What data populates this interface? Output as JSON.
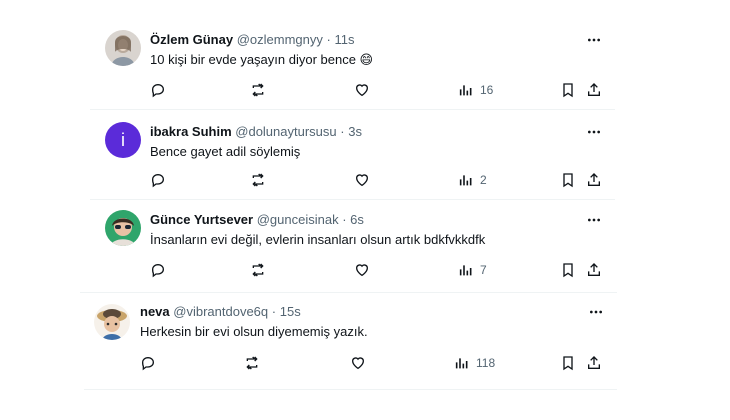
{
  "colors": {
    "text": "#0f1419",
    "muted": "#536471",
    "separator": "#eff3f4",
    "avatar_purple": "#5b2bd9"
  },
  "tweets": [
    {
      "name": "Özlem Günay",
      "handle": "@ozlemmgnyy",
      "time": "11s",
      "text": "10 kişi bir evde yaşayın diyor bence 😄",
      "views": "16"
    },
    {
      "name": "ibakra Suhim",
      "handle": "@dolunaytursusu",
      "time": "3s",
      "text": "Bence gayet adil söylemiş",
      "views": "2",
      "avatar_letter": "i"
    },
    {
      "name": "Günce Yurtsever",
      "handle": "@gunceisinak",
      "time": "6s",
      "text": "İnsanların evi değil, evlerin insanları olsun artık bdkfvkkdfk",
      "views": "7"
    },
    {
      "name": "neva",
      "handle": "@vibrantdove6q",
      "time": "15s",
      "text": "Herkesin bir evi olsun diyememiş yazık.",
      "views": "118"
    }
  ],
  "icons": {
    "reply": "reply-icon",
    "retweet": "retweet-icon",
    "like": "heart-icon",
    "views": "views-chart-icon",
    "bookmark": "bookmark-icon",
    "share": "share-icon",
    "more": "more-dots-icon"
  },
  "separator_dot": "·"
}
